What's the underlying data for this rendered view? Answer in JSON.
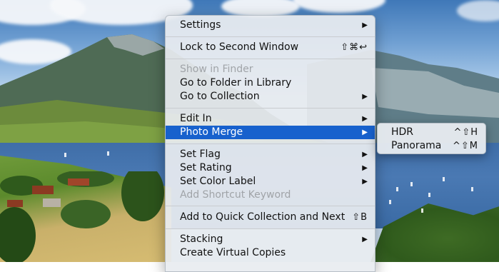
{
  "menu": {
    "items": [
      {
        "label": "Settings",
        "state": "normal",
        "submenu": true,
        "shortcut": ""
      },
      {
        "label": "Lock to Second Window",
        "state": "normal",
        "submenu": false,
        "shortcut": "⇧⌘↩"
      },
      {
        "label": "Show in Finder",
        "state": "disabled",
        "submenu": false,
        "shortcut": ""
      },
      {
        "label": "Go to Folder in Library",
        "state": "normal",
        "submenu": false,
        "shortcut": ""
      },
      {
        "label": "Go to Collection",
        "state": "normal",
        "submenu": true,
        "shortcut": ""
      },
      {
        "label": "Edit In",
        "state": "normal",
        "submenu": true,
        "shortcut": ""
      },
      {
        "label": "Photo Merge",
        "state": "selected",
        "submenu": true,
        "shortcut": ""
      },
      {
        "label": "Set Flag",
        "state": "normal",
        "submenu": true,
        "shortcut": ""
      },
      {
        "label": "Set Rating",
        "state": "normal",
        "submenu": true,
        "shortcut": ""
      },
      {
        "label": "Set Color Label",
        "state": "normal",
        "submenu": true,
        "shortcut": ""
      },
      {
        "label": "Add Shortcut Keyword",
        "state": "disabled",
        "submenu": false,
        "shortcut": ""
      },
      {
        "label": "Add to Quick Collection and Next",
        "state": "normal",
        "submenu": false,
        "shortcut": "⇧B"
      },
      {
        "label": "Stacking",
        "state": "normal",
        "submenu": true,
        "shortcut": ""
      },
      {
        "label": "Create Virtual Copies",
        "state": "normal",
        "submenu": false,
        "shortcut": ""
      }
    ],
    "submenu_arrow": "▶"
  },
  "submenu": {
    "items": [
      {
        "label": "HDR",
        "shortcut": "^⇧H"
      },
      {
        "label": "Panorama",
        "shortcut": "^⇧M"
      }
    ]
  },
  "colors": {
    "selection": "#1761cd",
    "disabled_text": "#a0a4a8"
  }
}
